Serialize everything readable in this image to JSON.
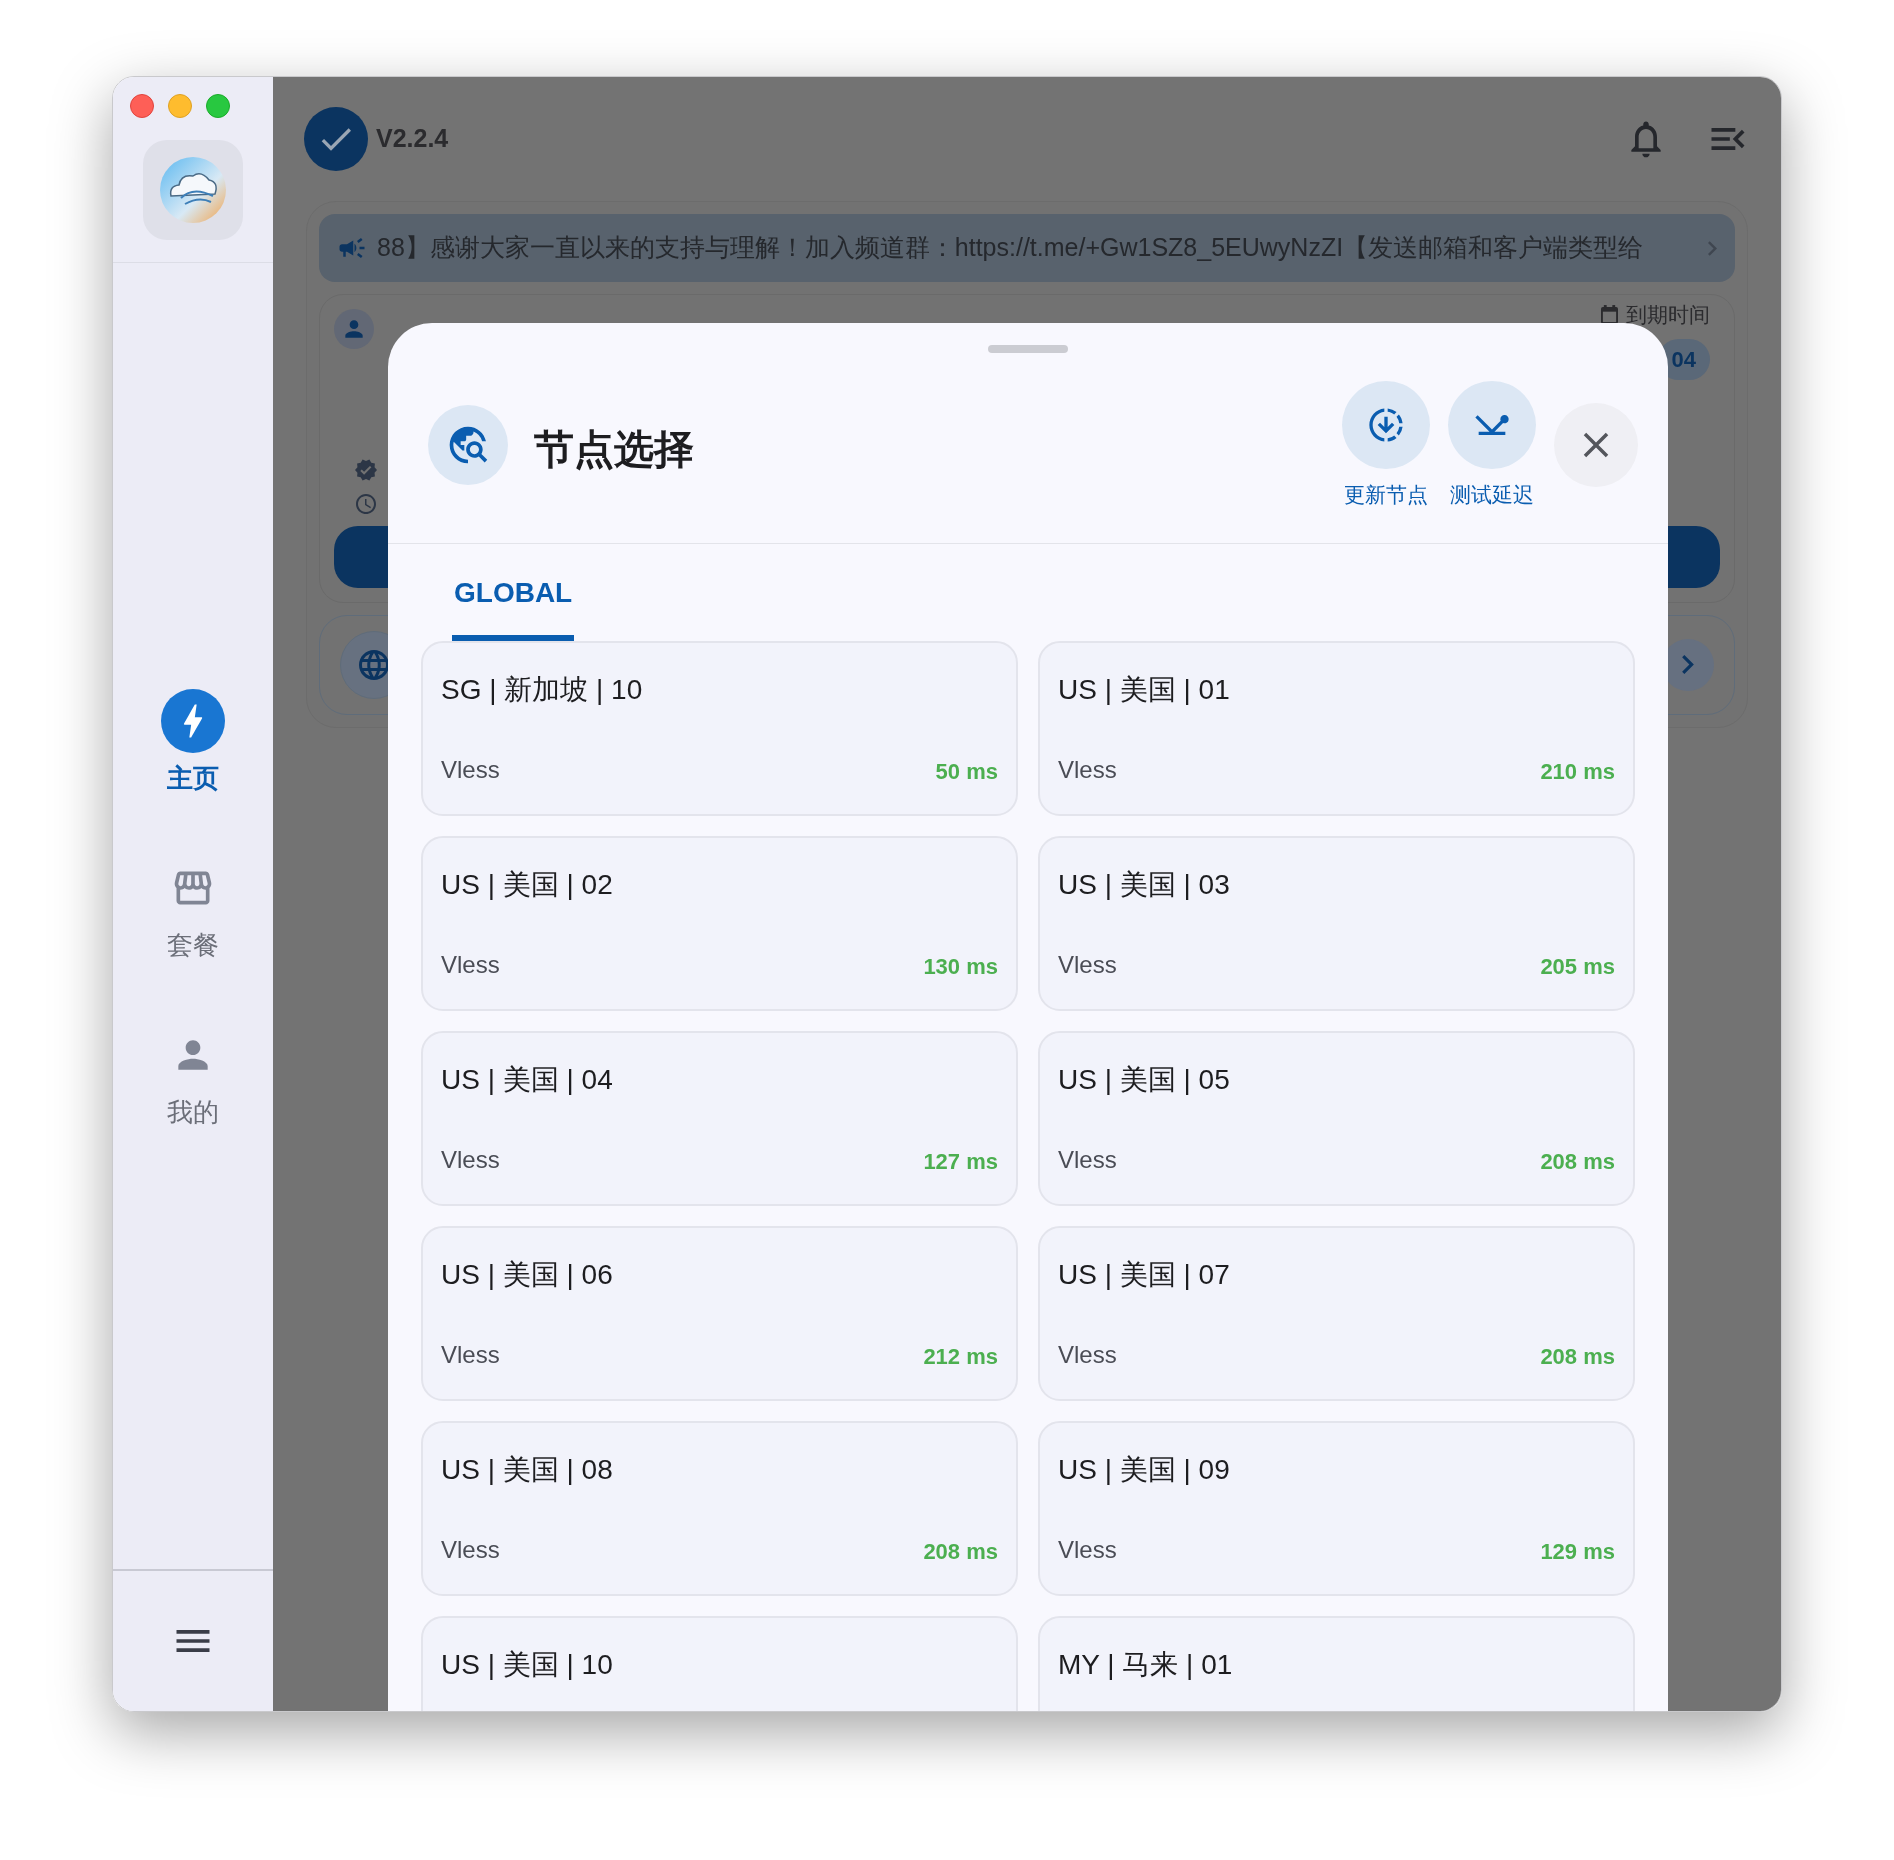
{
  "sidebar": {
    "nav": [
      {
        "label": "主页",
        "kind": "home",
        "selected": true
      },
      {
        "label": "套餐",
        "kind": "plans",
        "selected": false
      },
      {
        "label": "我的",
        "kind": "profile",
        "selected": false
      }
    ]
  },
  "header": {
    "version": "V2.2.4"
  },
  "banner": {
    "text": "88】感谢大家一直以来的支持与理解！加入频道群：https://t.me/+Gw1SZ8_5EUwyNzZI【发送邮箱和客户端类型给"
  },
  "account": {
    "expiry_label": "到期时间",
    "expiry_value": "04"
  },
  "sheet": {
    "title": "节点选择",
    "actions": [
      {
        "label": "更新节点",
        "kind": "update"
      },
      {
        "label": "测试延迟",
        "kind": "ping"
      }
    ],
    "tabs": [
      {
        "label": "GLOBAL",
        "selected": true
      }
    ],
    "nodes": [
      {
        "name": "SG | 新加坡 | 10",
        "protocol": "Vless",
        "latency": "50 ms"
      },
      {
        "name": "US | 美国 | 01",
        "protocol": "Vless",
        "latency": "210 ms"
      },
      {
        "name": "US | 美国 | 02",
        "protocol": "Vless",
        "latency": "130 ms"
      },
      {
        "name": "US | 美国 | 03",
        "protocol": "Vless",
        "latency": "205 ms"
      },
      {
        "name": "US | 美国 | 04",
        "protocol": "Vless",
        "latency": "127 ms"
      },
      {
        "name": "US | 美国 | 05",
        "protocol": "Vless",
        "latency": "208 ms"
      },
      {
        "name": "US | 美国 | 06",
        "protocol": "Vless",
        "latency": "212 ms"
      },
      {
        "name": "US | 美国 | 07",
        "protocol": "Vless",
        "latency": "208 ms"
      },
      {
        "name": "US | 美国 | 08",
        "protocol": "Vless",
        "latency": "208 ms"
      },
      {
        "name": "US | 美国 | 09",
        "protocol": "Vless",
        "latency": "129 ms"
      },
      {
        "name": "US | 美国 | 10"
      },
      {
        "name": "MY | 马来 | 01"
      }
    ]
  }
}
